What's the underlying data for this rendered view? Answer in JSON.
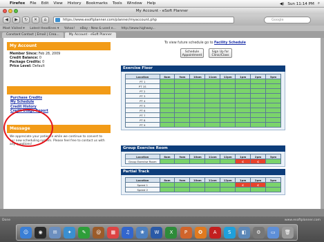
{
  "menubar": {
    "app_name": "Firefox",
    "items": [
      "File",
      "Edit",
      "View",
      "History",
      "Bookmarks",
      "Tools",
      "Window",
      "Help"
    ],
    "clock": "Sun 11:14 PM"
  },
  "browser": {
    "window_title": "My Account - eSoft Planner",
    "url": "https://www.esoftplanner.com/planner/myaccount.php",
    "search_placeholder": "Google",
    "bookmarks": [
      "Most Visited ▾",
      "Latest Headlines ▾",
      "Yahoo!",
      "eBay - New & used e...",
      "http://www.highway..."
    ],
    "tabs": [
      {
        "label": "Constant Contact | Email | Crea..."
      },
      {
        "label": "My Account - eSoft Planner"
      }
    ]
  },
  "sidebar": {
    "account_title": "My Account",
    "account_fields": [
      {
        "label": "Member Since:",
        "value": "Feb 28, 2009"
      },
      {
        "label": "Credit Balance:",
        "value": "0"
      },
      {
        "label": "Package Credits:",
        "value": "0"
      },
      {
        "label": "Price Level:",
        "value": "Default"
      }
    ],
    "links_title": "",
    "links": [
      "Purchase Credits",
      "My Schedule",
      "Credit History",
      "Credit Usage Report"
    ],
    "message_title": "Message",
    "message_text": "We appreciate your patience while we continue to convert to our new scheduling system. Please feel free to contact us with any questions!"
  },
  "main": {
    "info_prefix": "To view future schedule go to",
    "info_link": "Facility Schedule",
    "buttons": [
      "Schedule Appointment",
      "Sign Up for Clinic/Class"
    ]
  },
  "sections": [
    {
      "title": "Exercise Floor",
      "columns": [
        "Location",
        "8am",
        "9am",
        "10am",
        "11am",
        "12pm",
        "1pm",
        "2pm",
        "3pm"
      ],
      "rows": [
        {
          "location": "PT 1",
          "cells": [
            "",
            "",
            "",
            "",
            "",
            "",
            "",
            ""
          ]
        },
        {
          "location": "PT 1S",
          "cells": [
            "",
            "",
            "",
            "",
            "",
            "",
            "",
            ""
          ]
        },
        {
          "location": "PT 2",
          "cells": [
            "",
            "",
            "",
            "",
            "",
            "",
            "",
            ""
          ]
        },
        {
          "location": "PT 3",
          "cells": [
            "",
            "",
            "",
            "",
            "",
            "",
            "",
            ""
          ]
        },
        {
          "location": "PT 4",
          "cells": [
            "",
            "",
            "",
            "",
            "",
            "",
            "",
            ""
          ]
        },
        {
          "location": "PT 5",
          "cells": [
            "",
            "",
            "",
            "",
            "",
            "",
            "",
            ""
          ]
        },
        {
          "location": "PT 6",
          "cells": [
            "",
            "",
            "",
            "",
            "",
            "",
            "",
            ""
          ]
        },
        {
          "location": "PT 7",
          "cells": [
            "",
            "",
            "",
            "",
            "",
            "",
            "",
            ""
          ]
        },
        {
          "location": "PT 8",
          "cells": [
            "",
            "",
            "",
            "",
            "",
            "",
            "",
            ""
          ]
        },
        {
          "location": "PT 9",
          "cells": [
            "",
            "",
            "",
            "",
            "",
            "",
            "",
            ""
          ]
        }
      ]
    },
    {
      "title": "Group Exercise Room",
      "columns": [
        "Location",
        "8am",
        "9am",
        "10am",
        "11am",
        "12pm",
        "1pm",
        "2pm",
        "3pm"
      ],
      "rows": [
        {
          "location": "Group Exercise Room",
          "cells": [
            "",
            "",
            "",
            "",
            "",
            "C",
            "C",
            ""
          ]
        }
      ]
    },
    {
      "title": "Partial Track",
      "columns": [
        "Location",
        "8am",
        "9am",
        "10am",
        "11am",
        "12pm",
        "1pm",
        "2pm",
        "3pm"
      ],
      "rows": [
        {
          "location": "Speed 1",
          "cells": [
            "",
            "",
            "",
            "",
            "",
            "C",
            "C",
            ""
          ]
        },
        {
          "location": "Speed 2",
          "cells": [
            "",
            "",
            "",
            "",
            "",
            "",
            "",
            ""
          ]
        }
      ]
    }
  ],
  "dock": {
    "left_label": "Done",
    "right_label": "www.esoftplanner.com",
    "icons": [
      {
        "name": "finder-icon",
        "glyph": "☺",
        "color": "#3b7fd6"
      },
      {
        "name": "dashboard-icon",
        "glyph": "◉",
        "color": "#2a2a2a"
      },
      {
        "name": "mail-icon",
        "glyph": "✉",
        "color": "#6c8fbf"
      },
      {
        "name": "safari-icon",
        "glyph": "✦",
        "color": "#3a8fd0"
      },
      {
        "name": "ichat-icon",
        "glyph": "✎",
        "color": "#2e9e3a"
      },
      {
        "name": "addressbook-icon",
        "glyph": "@",
        "color": "#9b5b2a"
      },
      {
        "name": "ical-icon",
        "glyph": "▦",
        "color": "#d44"
      },
      {
        "name": "itunes-icon",
        "glyph": "♫",
        "color": "#3366cc"
      },
      {
        "name": "iphoto-icon",
        "glyph": "❀",
        "color": "#4c7fbf"
      },
      {
        "name": "word-icon",
        "glyph": "W",
        "color": "#2b5aa6"
      },
      {
        "name": "excel-icon",
        "glyph": "X",
        "color": "#2e8b3a"
      },
      {
        "name": "powerpoint-icon",
        "glyph": "P",
        "color": "#d0642b"
      },
      {
        "name": "firefox-icon",
        "glyph": "✪",
        "color": "#e07a1f"
      },
      {
        "name": "acrobat-icon",
        "glyph": "A",
        "color": "#c21f1f"
      },
      {
        "name": "skype-icon",
        "glyph": "S",
        "color": "#1fa0dc"
      },
      {
        "name": "preview-icon",
        "glyph": "◧",
        "color": "#5d88b8"
      },
      {
        "name": "sysprefs-icon",
        "glyph": "⚙",
        "color": "#777"
      },
      {
        "name": "folder-icon",
        "glyph": "▭",
        "color": "#5e8fd8"
      },
      {
        "name": "trash-icon",
        "glyph": "🗑",
        "color": "#9a9a9a"
      }
    ]
  }
}
